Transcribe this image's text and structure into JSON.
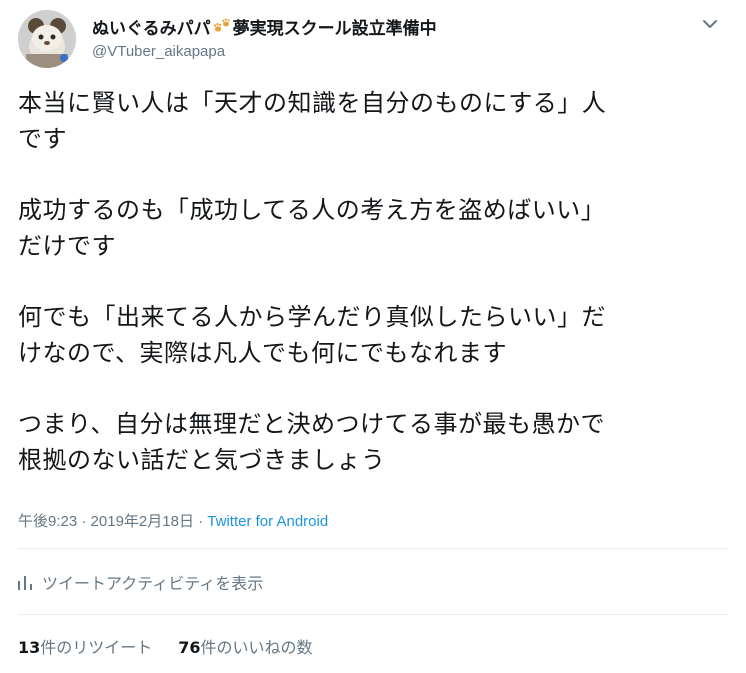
{
  "user": {
    "display_name_prefix": "ぬいぐるみパパ",
    "display_name_suffix": "夢実現スクール設立準備中",
    "paw_icon": "paw-prints-icon",
    "handle": "@VTuber_aikapapa",
    "avatar_icon": "plush-toy-avatar"
  },
  "tweet": {
    "paragraphs": [
      [
        "本当に賢い人は「天才の知識を自分のものにする」人",
        "です"
      ],
      [
        "成功するのも「成功してる人の考え方を盗めばいい」",
        "だけです"
      ],
      [
        "何でも「出来てる人から学んだり真似したらいい」だ",
        "けなので、実際は凡人でも何にでもなれます"
      ],
      [
        "つまり、自分は無理だと決めつけてる事が最も愚かで",
        "根拠のない話だと気づきましょう"
      ]
    ],
    "time": "午後9:23",
    "separator": "·",
    "date": "2019年2月18日",
    "source": "Twitter for Android",
    "activity_label": "ツイートアクティビティを表示",
    "retweets": {
      "count": "13",
      "label": "件のリツイート"
    },
    "likes": {
      "count": "76",
      "label": "件のいいねの数"
    }
  },
  "colors": {
    "text": "#14171a",
    "secondary": "#657786",
    "link": "#1b95e0",
    "divider": "#e6ecf0",
    "paw": "#e8a33d"
  },
  "icons": {
    "caret": "chevron-down-icon",
    "activity": "bar-chart-icon"
  }
}
